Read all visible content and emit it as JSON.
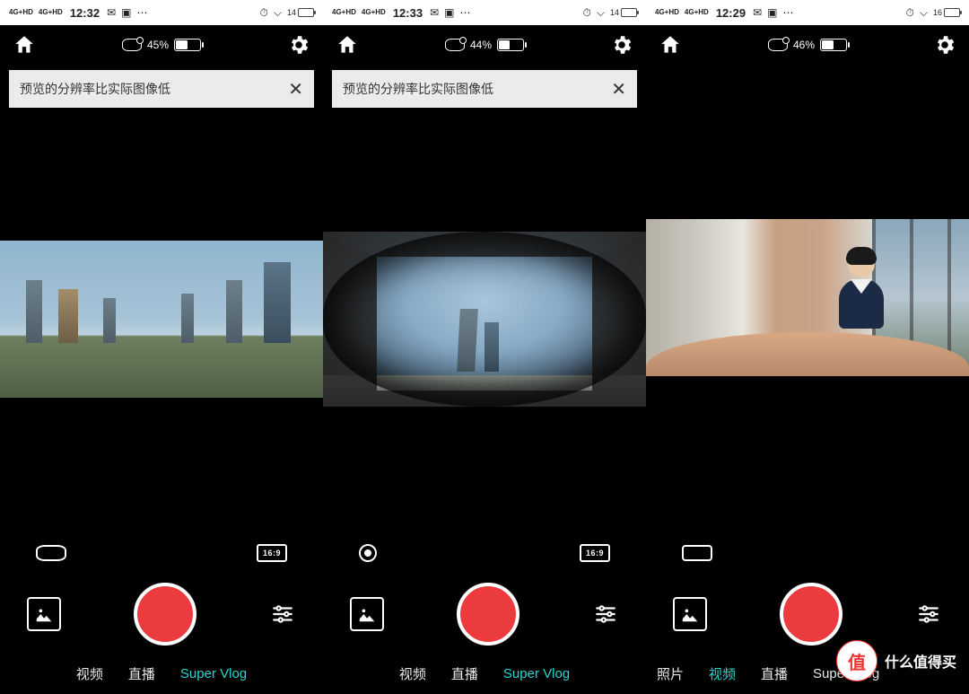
{
  "statusbar": {
    "signal_label": "4G+HD",
    "icons": {
      "alarm": "⏰",
      "wifi": "📶",
      "chat": "💬",
      "cam": "📷",
      "more": "⋯"
    }
  },
  "screens": [
    {
      "time": "12:32",
      "sys_battery": "14",
      "cam_battery": {
        "percent": "45%",
        "fill_pct": 45
      },
      "banner": "预览的分辨率比实际图像低",
      "has_banner": true,
      "ctrl_left": "wide",
      "aspect": "16:9",
      "modes": [
        "视频",
        "直播",
        "Super Vlog"
      ],
      "active_mode": 2,
      "modes_align": "center",
      "preview_class": "pv-a"
    },
    {
      "time": "12:33",
      "sys_battery": "14",
      "cam_battery": {
        "percent": "44%",
        "fill_pct": 44
      },
      "banner": "预览的分辨率比实际图像低",
      "has_banner": true,
      "ctrl_left": "circle",
      "aspect": "16:9",
      "modes": [
        "视频",
        "直播",
        "Super Vlog"
      ],
      "active_mode": 2,
      "modes_align": "center",
      "preview_class": "pv-b"
    },
    {
      "time": "12:29",
      "sys_battery": "16",
      "cam_battery": {
        "percent": "46%",
        "fill_pct": 46
      },
      "banner": "",
      "has_banner": false,
      "ctrl_left": "rect",
      "aspect": "",
      "modes": [
        "照片",
        "视频",
        "直播",
        "Super Vlog"
      ],
      "active_mode": 1,
      "modes_align": "left",
      "preview_class": "pv-c"
    }
  ],
  "watermark": {
    "badge": "值",
    "text": "什么值得买"
  }
}
